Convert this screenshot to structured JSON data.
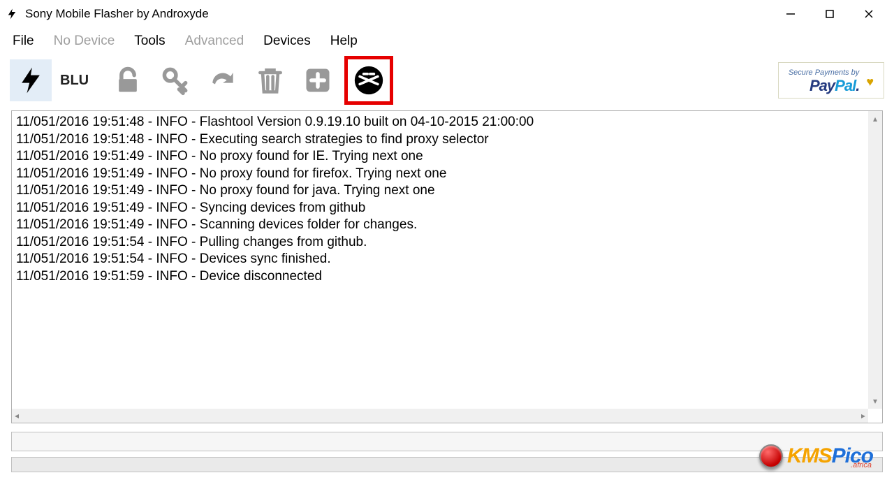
{
  "window": {
    "title": "Sony Mobile Flasher by Androxyde"
  },
  "menu": {
    "file": "File",
    "no_device": "No Device",
    "tools": "Tools",
    "advanced": "Advanced",
    "devices": "Devices",
    "help": "Help"
  },
  "toolbar": {
    "mode_label": "BLU"
  },
  "paypal": {
    "secure": "Secure Payments by",
    "brand1": "Pay",
    "brand2": "Pal"
  },
  "log": {
    "lines": [
      "11/051/2016 19:51:48 - INFO  - Flashtool Version 0.9.19.10 built on 04-10-2015 21:00:00",
      "11/051/2016 19:51:48 - INFO  - Executing search strategies to find proxy selector",
      "11/051/2016 19:51:49 - INFO  - No proxy found for IE. Trying next one",
      "11/051/2016 19:51:49 - INFO  - No proxy found for firefox. Trying next one",
      "11/051/2016 19:51:49 - INFO  - No proxy found for java. Trying next one",
      "11/051/2016 19:51:49 - INFO  - Syncing devices from github",
      "11/051/2016 19:51:49 - INFO  - Scanning devices folder for changes.",
      "11/051/2016 19:51:54 - INFO  - Pulling changes from github.",
      "11/051/2016 19:51:54 - INFO  - Devices sync finished.",
      "11/051/2016 19:51:59 - INFO  - Device disconnected"
    ]
  },
  "watermark": {
    "text1": "KMS",
    "text2": "Pico",
    "sub": ".africa"
  }
}
